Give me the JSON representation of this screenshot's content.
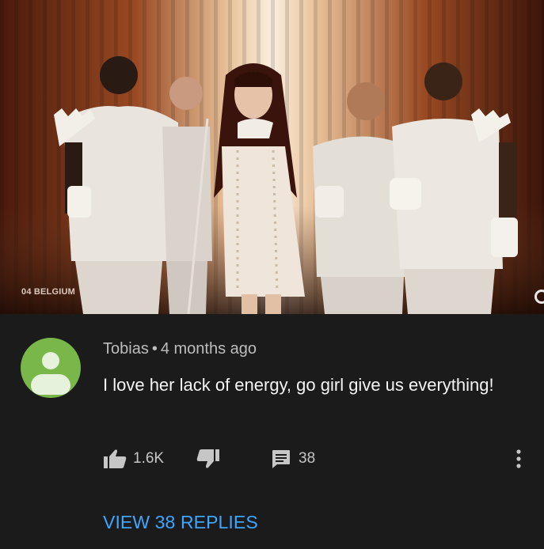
{
  "video": {
    "overlay_label": "04 BELGIUM",
    "colors": {
      "curtain": "#8a3c1c",
      "light": "#f6e2c4"
    }
  },
  "comment": {
    "author": "Tobias",
    "separator": "•",
    "timestamp": "4 months ago",
    "text": "I love her lack of energy, go girl give us everything!",
    "likes": "1.6K",
    "reply_count": "38",
    "view_replies_label": "VIEW 38 REPLIES",
    "avatar_color": "#79b74a",
    "link_color": "#3ea6ff"
  },
  "icons": [
    "thumbs-up-icon",
    "thumbs-down-icon",
    "reply-icon",
    "more-vertical-icon"
  ]
}
